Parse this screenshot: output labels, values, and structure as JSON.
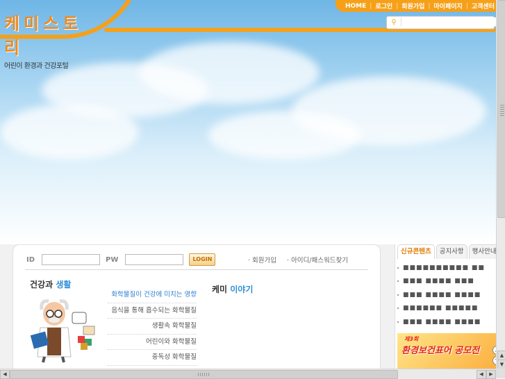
{
  "logo": {
    "title": "케미스토리",
    "subtitle": "어린이 환경과 건강포털"
  },
  "topnav": {
    "items": [
      "HOME",
      "로그인",
      "회원가입",
      "마이페이지",
      "고객센터"
    ]
  },
  "search": {
    "placeholder": ""
  },
  "login": {
    "id_label": "ID",
    "pw_label": "PW",
    "button_label": "LOGIN",
    "links": [
      "· 회원가입",
      "· 아이디/패스워드찾기"
    ]
  },
  "health_life": {
    "title_plain": "건강과 ",
    "title_highlight": "생활",
    "items": [
      "화학물질이 건강에 미치는 영향",
      "음식을 통해 흡수되는 화학물질",
      "생활속 화학물질",
      "어린이와 화학물질",
      "중독성 화학물질"
    ]
  },
  "chemi_story": {
    "title_plain": "케미 ",
    "title_highlight": "이야기"
  },
  "right_tabs": [
    "신규콘텐츠",
    "공지사항",
    "행사안내"
  ],
  "news_items": [
    "■■■■■■■■■■ ■■",
    "■■■ ■■■■ ■■■",
    "■■■ ■■■■ ■■■■",
    "■■■■■■ ■■■■■",
    "■■■ ■■■■ ■■■■"
  ],
  "banner": {
    "sup": "제3회",
    "text": "환경보건표어 공모전"
  }
}
